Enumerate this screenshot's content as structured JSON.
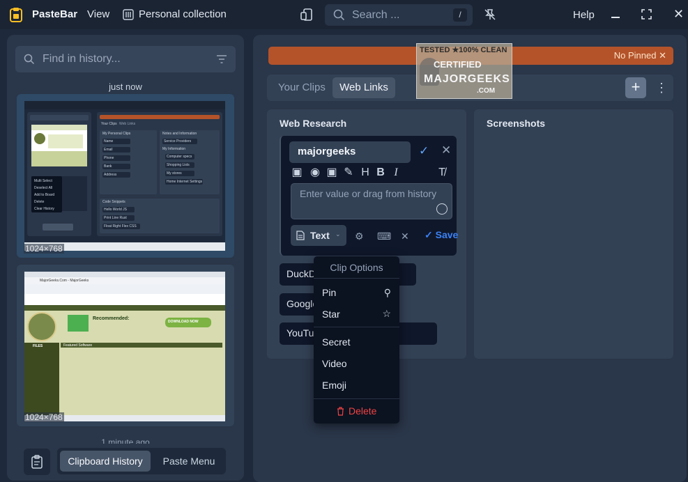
{
  "app": {
    "name": "PasteBar",
    "view_menu": "View",
    "collection": "Personal collection",
    "search_placeholder": "Search ...",
    "search_shortcut": "/",
    "help": "Help"
  },
  "history": {
    "find_placeholder": "Find in history...",
    "timestamp_recent": "just now",
    "timestamp_older": "1 minute ago",
    "clips": [
      {
        "resolution": "1024×768"
      },
      {
        "resolution": "1024×768"
      }
    ],
    "bottom": {
      "clipboard_history": "Clipboard History",
      "paste_menu": "Paste Menu"
    }
  },
  "main": {
    "pinned_label": "No Pinned",
    "tabs": [
      {
        "label": "Your Clips"
      },
      {
        "label": "Web Links"
      }
    ],
    "boards": [
      {
        "title": "Web Research",
        "editor": {
          "name_value": "majorgeeks",
          "value_placeholder": "Enter value or drag from history",
          "type": "Text",
          "save_label": "Save"
        },
        "clips": [
          "DuckDuckGo",
          "Google",
          "YouTube Videos"
        ]
      },
      {
        "title": "Screenshots"
      }
    ]
  },
  "context_menu": {
    "header": "Clip Options",
    "items": [
      "Pin",
      "Star",
      "Secret",
      "Video",
      "Emoji"
    ],
    "delete": "Delete"
  },
  "watermark": {
    "line1": "TESTED ★100% CLEAN",
    "line2": "CERTIFIED",
    "line3": "MAJORGEEKS",
    "line4": ".COM"
  },
  "mini_shot_1": {
    "your_clips": "Your Clips",
    "web_links": "Web Links",
    "my_personal_clips": "My Personal Clips",
    "notes": "Notes and Information",
    "personal_items": [
      "Name",
      "Email",
      "Phone",
      "Bank",
      "Address"
    ],
    "notes_items": [
      "Service Providers",
      "My Information",
      "Computer specs",
      "Shopping Lists",
      "My stores",
      "Home Internet Settings"
    ],
    "code_snippets": "Code Snippets",
    "code_items": [
      "Hello World JS",
      "Print Line Rust",
      "Float Right Flex CSS"
    ],
    "menu_items": [
      "Multi Select",
      "Deselect All",
      "Add to Board",
      "Delete",
      "Clear History"
    ]
  },
  "mini_shot_2": {
    "site": "MajorGeeks.Com - MajorGeeks",
    "recommended": "Recommended:",
    "download": "DOWNLOAD NOW",
    "files": "FILES",
    "featured": "Featured Software"
  }
}
